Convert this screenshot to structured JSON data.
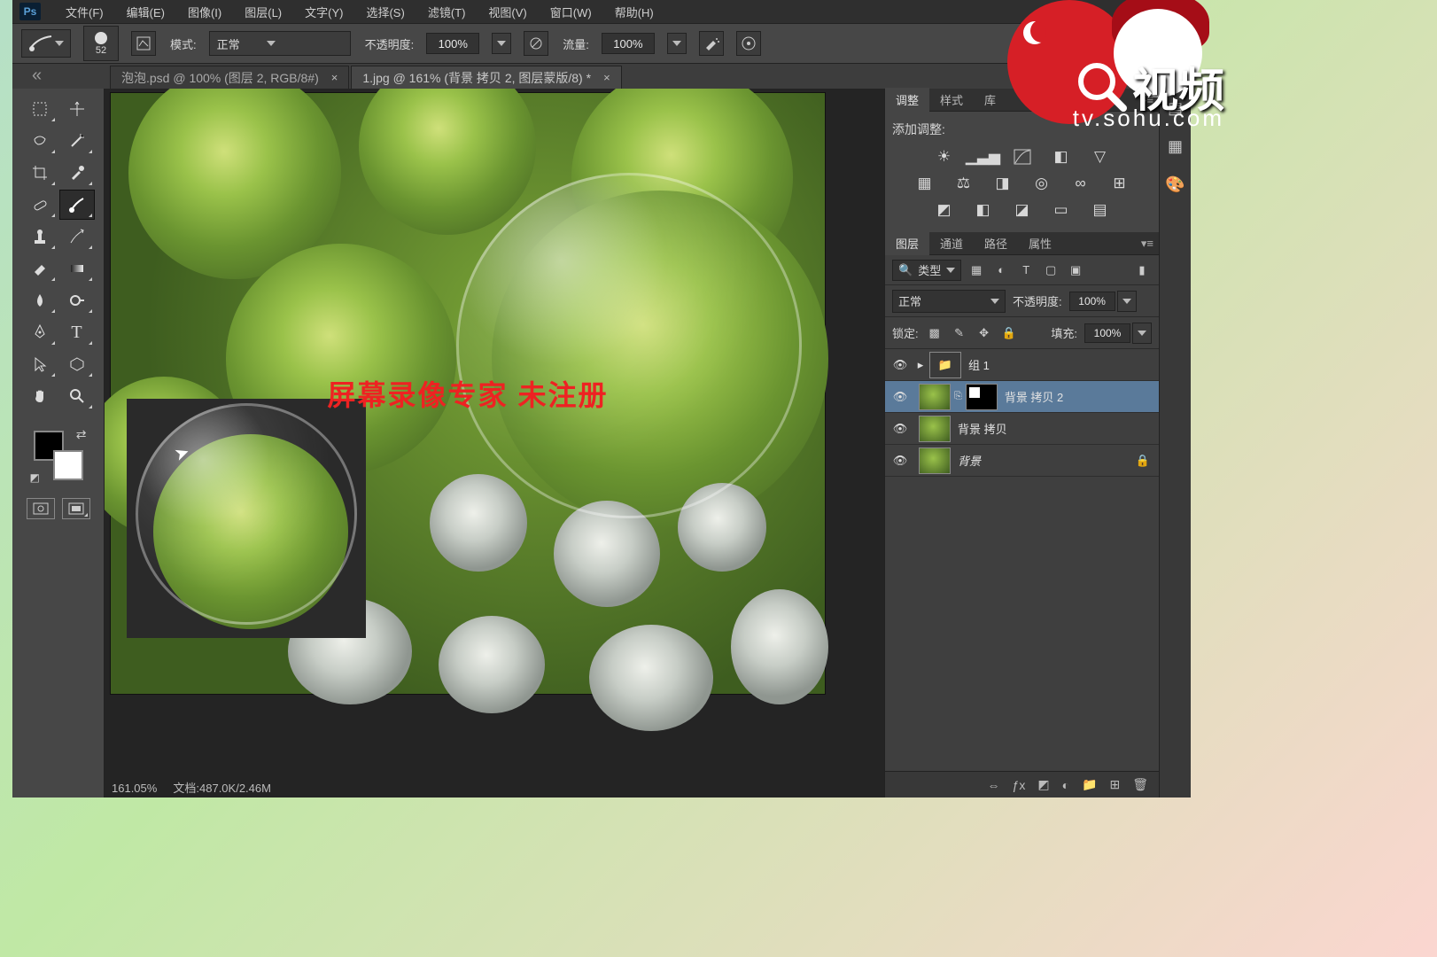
{
  "app": {
    "logo": "Ps"
  },
  "menu": {
    "file": "文件(F)",
    "edit": "编辑(E)",
    "image": "图像(I)",
    "layer": "图层(L)",
    "type": "文字(Y)",
    "select": "选择(S)",
    "filter": "滤镜(T)",
    "view": "视图(V)",
    "window": "窗口(W)",
    "help": "帮助(H)"
  },
  "options": {
    "brush_size": "52",
    "mode_label": "模式:",
    "mode_value": "正常",
    "opacity_label": "不透明度:",
    "opacity_value": "100%",
    "flow_label": "流量:",
    "flow_value": "100%"
  },
  "tabs": {
    "t1": "泡泡.psd @ 100% (图层 2, RGB/8#)",
    "t2": "1.jpg @ 161% (背景 拷贝 2, 图层蒙版/8) *"
  },
  "canvas": {
    "watermark": "屏幕录像专家  未注册",
    "status_zoom": "161.05%",
    "status_doc": "文档:487.0K/2.46M"
  },
  "adjust_panel": {
    "tab_adjust": "调整",
    "tab_style": "样式",
    "tab_lib": "库",
    "title": "添加调整:"
  },
  "layers_panel": {
    "tab_layers": "图层",
    "tab_channels": "通道",
    "tab_paths": "路径",
    "tab_props": "属性",
    "kind_label": "类型",
    "blend_mode": "正常",
    "opacity_label": "不透明度:",
    "opacity_value": "100%",
    "lock_label": "锁定:",
    "fill_label": "填充:",
    "fill_value": "100%",
    "layers": [
      {
        "name": "组 1"
      },
      {
        "name": "背景 拷贝 2"
      },
      {
        "name": "背景 拷贝"
      },
      {
        "name": "背景"
      }
    ]
  },
  "sohu": {
    "han": "视频",
    "url": "tv.sohu.com"
  }
}
